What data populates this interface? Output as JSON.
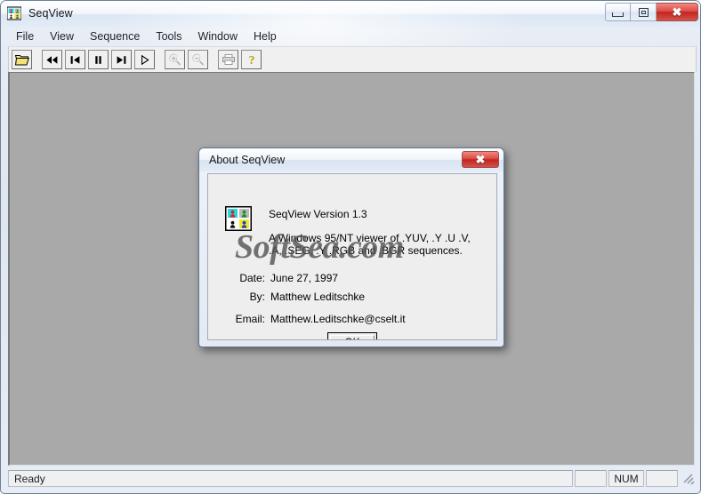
{
  "window": {
    "title": "SeqView",
    "icon": "seqview-app-icon",
    "controls": {
      "minimize": "minimize-button",
      "maximize": "maximize-button",
      "close": "close-button",
      "close_glyph": "✖"
    }
  },
  "menubar": {
    "items": [
      {
        "label": "File"
      },
      {
        "label": "View"
      },
      {
        "label": "Sequence"
      },
      {
        "label": "Tools"
      },
      {
        "label": "Window"
      },
      {
        "label": "Help"
      }
    ]
  },
  "toolbar": {
    "buttons": [
      {
        "name": "open-file-button",
        "icon": "open-folder-icon",
        "enabled": true
      },
      {
        "name": "rewind-button",
        "icon": "rewind-icon",
        "enabled": true
      },
      {
        "name": "previous-frame-button",
        "icon": "skip-previous-icon",
        "enabled": true
      },
      {
        "name": "pause-button",
        "icon": "pause-icon",
        "enabled": true
      },
      {
        "name": "next-frame-button",
        "icon": "skip-next-icon",
        "enabled": true
      },
      {
        "name": "play-button",
        "icon": "play-icon",
        "enabled": true
      },
      {
        "name": "zoom-in-button",
        "icon": "zoom-in-icon",
        "enabled": false
      },
      {
        "name": "zoom-out-button",
        "icon": "zoom-out-icon",
        "enabled": false
      },
      {
        "name": "print-button",
        "icon": "printer-icon",
        "enabled": false
      },
      {
        "name": "help-button",
        "icon": "question-mark-icon",
        "enabled": true
      }
    ]
  },
  "statusbar": {
    "message": "Ready",
    "pane_small": "",
    "pane_num": "NUM",
    "pane_extra": ""
  },
  "dialog": {
    "title": "About SeqView",
    "icon": "seqview-app-icon",
    "version": "SeqView Version 1.3",
    "description": "A Windows 95/NT viewer of .YUV, .Y .U .V,\n.A, .SEG, .Y .RGB and .BGR sequences.",
    "fields": [
      {
        "label": "Date:",
        "value": "June 27, 1997"
      },
      {
        "label": "By:",
        "value": "Matthew Leditschke"
      },
      {
        "label": "Email:",
        "value": "Matthew.Leditschke@cselt.it"
      }
    ],
    "ok_label": "OK",
    "close_glyph": "✖"
  },
  "watermark": {
    "text": "SoftSea.com"
  },
  "colors": {
    "client_area": "#a9a9a9",
    "dialog_face": "#eeeeee",
    "close_button_red": "#c2251d",
    "toolbar_face": "#f0f0f0",
    "titlebar_text": "#10161d"
  }
}
